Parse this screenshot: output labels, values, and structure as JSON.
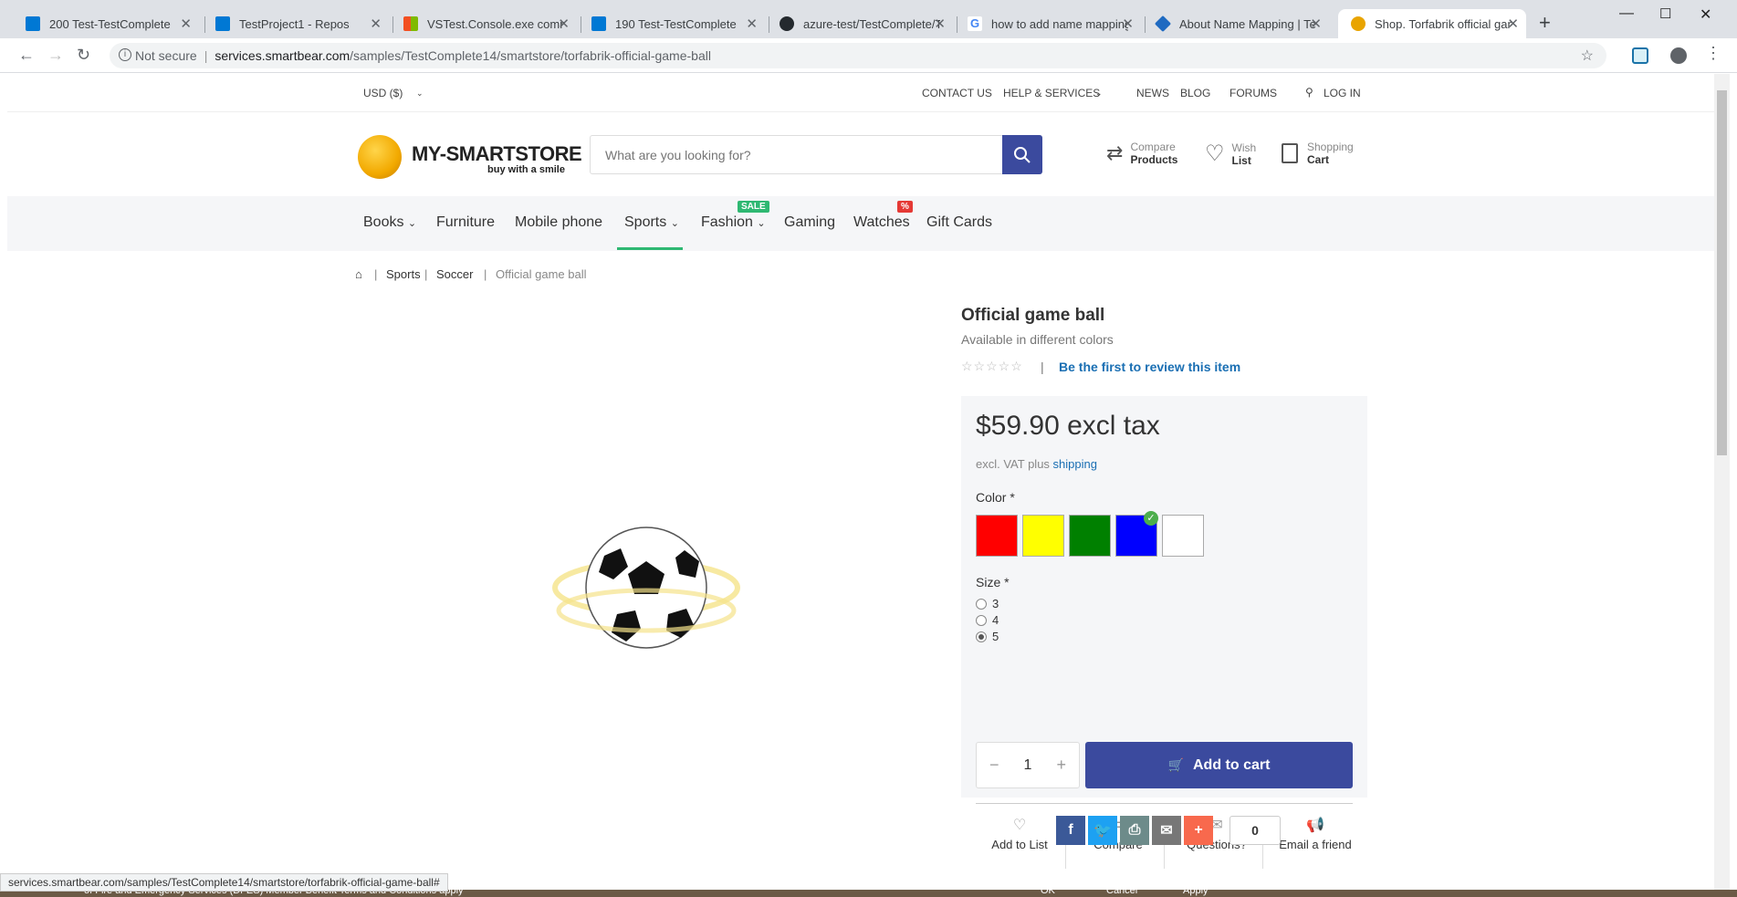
{
  "browser": {
    "tabs": [
      {
        "title": "200 Test-TestComplete",
        "icon_color": "#0078d4"
      },
      {
        "title": "TestProject1 - Repos",
        "icon_color": "#0078d4"
      },
      {
        "title": "VSTest.Console.exe comma",
        "icon_color": "#f25022"
      },
      {
        "title": "190 Test-TestComplete",
        "icon_color": "#0078d4"
      },
      {
        "title": "azure-test/TestComplete/T",
        "icon_color": "#24292e"
      },
      {
        "title": "how to add name mapping",
        "icon_color": "#4285f4"
      },
      {
        "title": "About Name Mapping | Tes",
        "icon_color": "#1f6ac1"
      },
      {
        "title": "Shop. Torfabrik official gam",
        "icon_color": "#e9a400"
      }
    ],
    "new_tab": "+",
    "not_secure": "Not secure",
    "url_host": "services.smartbear.com",
    "url_path": "/samples/TestComplete14/smartstore/torfabrik-official-game-ball",
    "status_url": "services.smartbear.com/samples/TestComplete14/smartstore/torfabrik-official-game-ball#"
  },
  "topbar": {
    "currency": "USD  ($)",
    "contact": "CONTACT US",
    "help": "HELP & SERVICES",
    "news": "NEWS",
    "blog": "BLOG",
    "forums": "FORUMS",
    "login": "LOG IN"
  },
  "header": {
    "logo": "MY-SMARTSTORE",
    "logo_sub": "buy with a smile",
    "search_placeholder": "What are you looking for?",
    "compare_1": "Compare",
    "compare_2": "Products",
    "wish_1": "Wish",
    "wish_2": "List",
    "cart_1": "Shopping",
    "cart_2": "Cart"
  },
  "menu": {
    "books": "Books",
    "furniture": "Furniture",
    "mobile": "Mobile phone",
    "sports": "Sports",
    "fashion": "Fashion",
    "fashion_badge": "SALE",
    "gaming": "Gaming",
    "watches": "Watches",
    "watches_badge": "%",
    "giftcards": "Gift Cards"
  },
  "breadcrumb": {
    "sports": "Sports",
    "soccer": "Soccer",
    "current": "Official game ball"
  },
  "product": {
    "title": "Official game ball",
    "subtitle": "Available in different colors",
    "review_link": "Be the first to review this item",
    "price": "$59.90 excl tax",
    "vat_text": "excl. VAT plus",
    "shipping": "shipping",
    "color_label": "Color *",
    "colors": [
      "#ff0000",
      "#ffff00",
      "#008000",
      "#0000ff",
      "#ffffff"
    ],
    "size_label": "Size *",
    "sizes": [
      "3",
      "4",
      "5"
    ],
    "quantity": "1",
    "add_to_cart": "Add to cart",
    "actions": {
      "add_to_list": "Add to List",
      "compare": "Compare",
      "questions": "Questions?",
      "email": "Email a friend"
    },
    "share_count": "0"
  },
  "background": {
    "peek_text": "of Fire and Emergency Services (DFES) Member Benefit Terms and Conditions apply",
    "ok": "OK",
    "cancel": "Cancel",
    "apply": "Apply"
  }
}
